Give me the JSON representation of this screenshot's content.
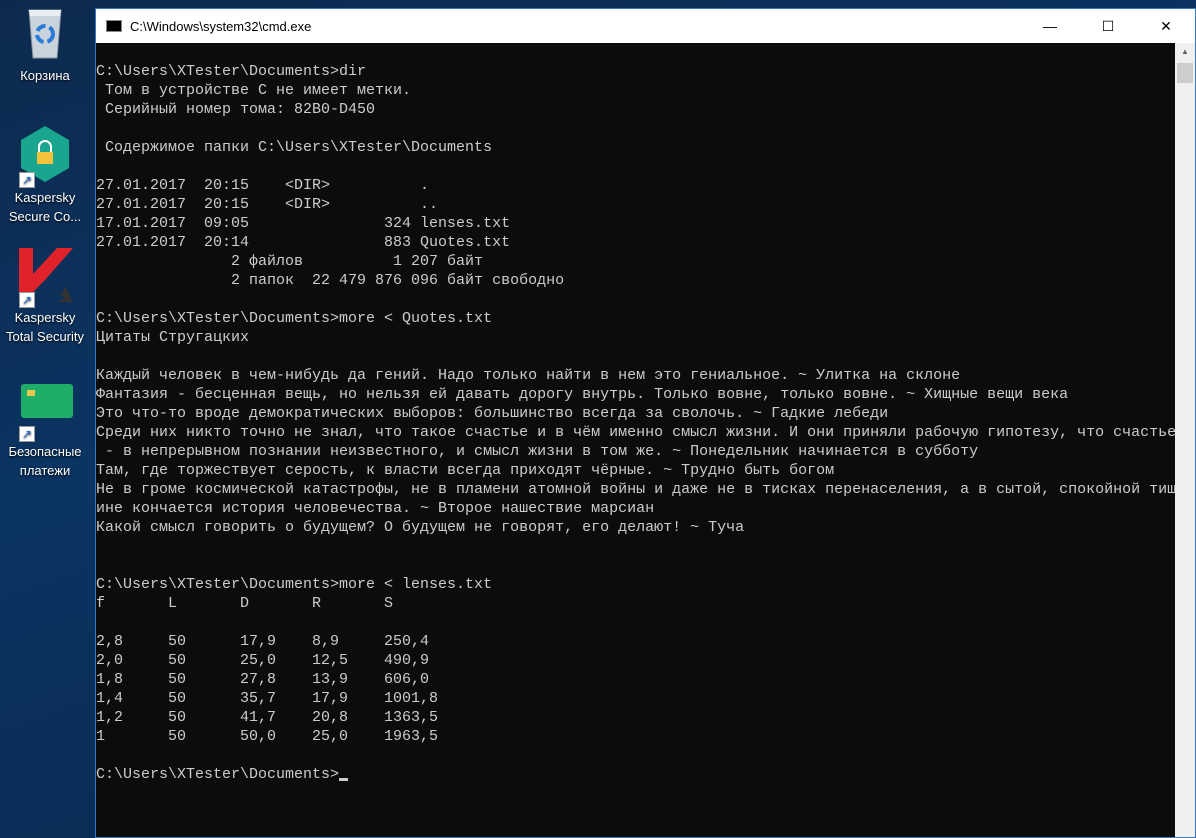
{
  "desktop": {
    "icons": [
      {
        "label": "Корзина",
        "icon": "recycle-bin-icon"
      },
      {
        "label": "Kaspersky Secure Co...",
        "icon": "kaspersky-secure-connection-icon"
      },
      {
        "label": "Kaspersky Total Security",
        "icon": "kaspersky-total-security-icon"
      },
      {
        "label": "Безопасные платежи",
        "icon": "safe-money-card-icon"
      }
    ]
  },
  "window": {
    "title": "C:\\Windows\\system32\\cmd.exe",
    "minimize": "—",
    "maximize": "☐",
    "close": "✕"
  },
  "console": {
    "lines": [
      "C:\\Users\\XTester\\Documents>dir",
      " Том в устройстве C не имеет метки.",
      " Серийный номер тома: 82B0-D450",
      "",
      " Содержимое папки C:\\Users\\XTester\\Documents",
      "",
      "27.01.2017  20:15    <DIR>          .",
      "27.01.2017  20:15    <DIR>          ..",
      "17.01.2017  09:05               324 lenses.txt",
      "27.01.2017  20:14               883 Quotes.txt",
      "               2 файлов          1 207 байт",
      "               2 папок  22 479 876 096 байт свободно",
      "",
      "C:\\Users\\XTester\\Documents>more < Quotes.txt",
      "Цитаты Стругацких",
      "",
      "Каждый человек в чем-нибудь да гений. Надо только найти в нем это гениальное. ~ Улитка на склоне",
      "Фантазия - бесценная вещь, но нельзя ей давать дорогу внутрь. Только вовне, только вовне. ~ Хищные вещи века",
      "Это что-то вроде демократических выборов: большинство всегда за сволочь. ~ Гадкие лебеди",
      "Среди них никто точно не знал, что такое счастье и в чём именно смысл жизни. И они приняли рабочую гипотезу, что счастье",
      " - в непрерывном познании неизвестного, и смысл жизни в том же. ~ Понедельник начинается в субботу",
      "Там, где торжествует серость, к власти всегда приходят чёрные. ~ Трудно быть богом",
      "Не в громе космической катастрофы, не в пламени атомной войны и даже не в тисках перенаселения, а в сытой, спокойной тиш",
      "ине кончается история человечества. ~ Второе нашествие марсиан",
      "Какой смысл говорить о будущем? О будущем не говорят, его делают! ~ Туча",
      "",
      "",
      "C:\\Users\\XTester\\Documents>more < lenses.txt",
      "f       L       D       R       S",
      "",
      "2,8     50      17,9    8,9     250,4",
      "2,0     50      25,0    12,5    490,9",
      "1,8     50      27,8    13,9    606,0",
      "1,4     50      35,7    17,9    1001,8",
      "1,2     50      41,7    20,8    1363,5",
      "1       50      50,0    25,0    1963,5",
      ""
    ],
    "prompt": "C:\\Users\\XTester\\Documents>"
  }
}
